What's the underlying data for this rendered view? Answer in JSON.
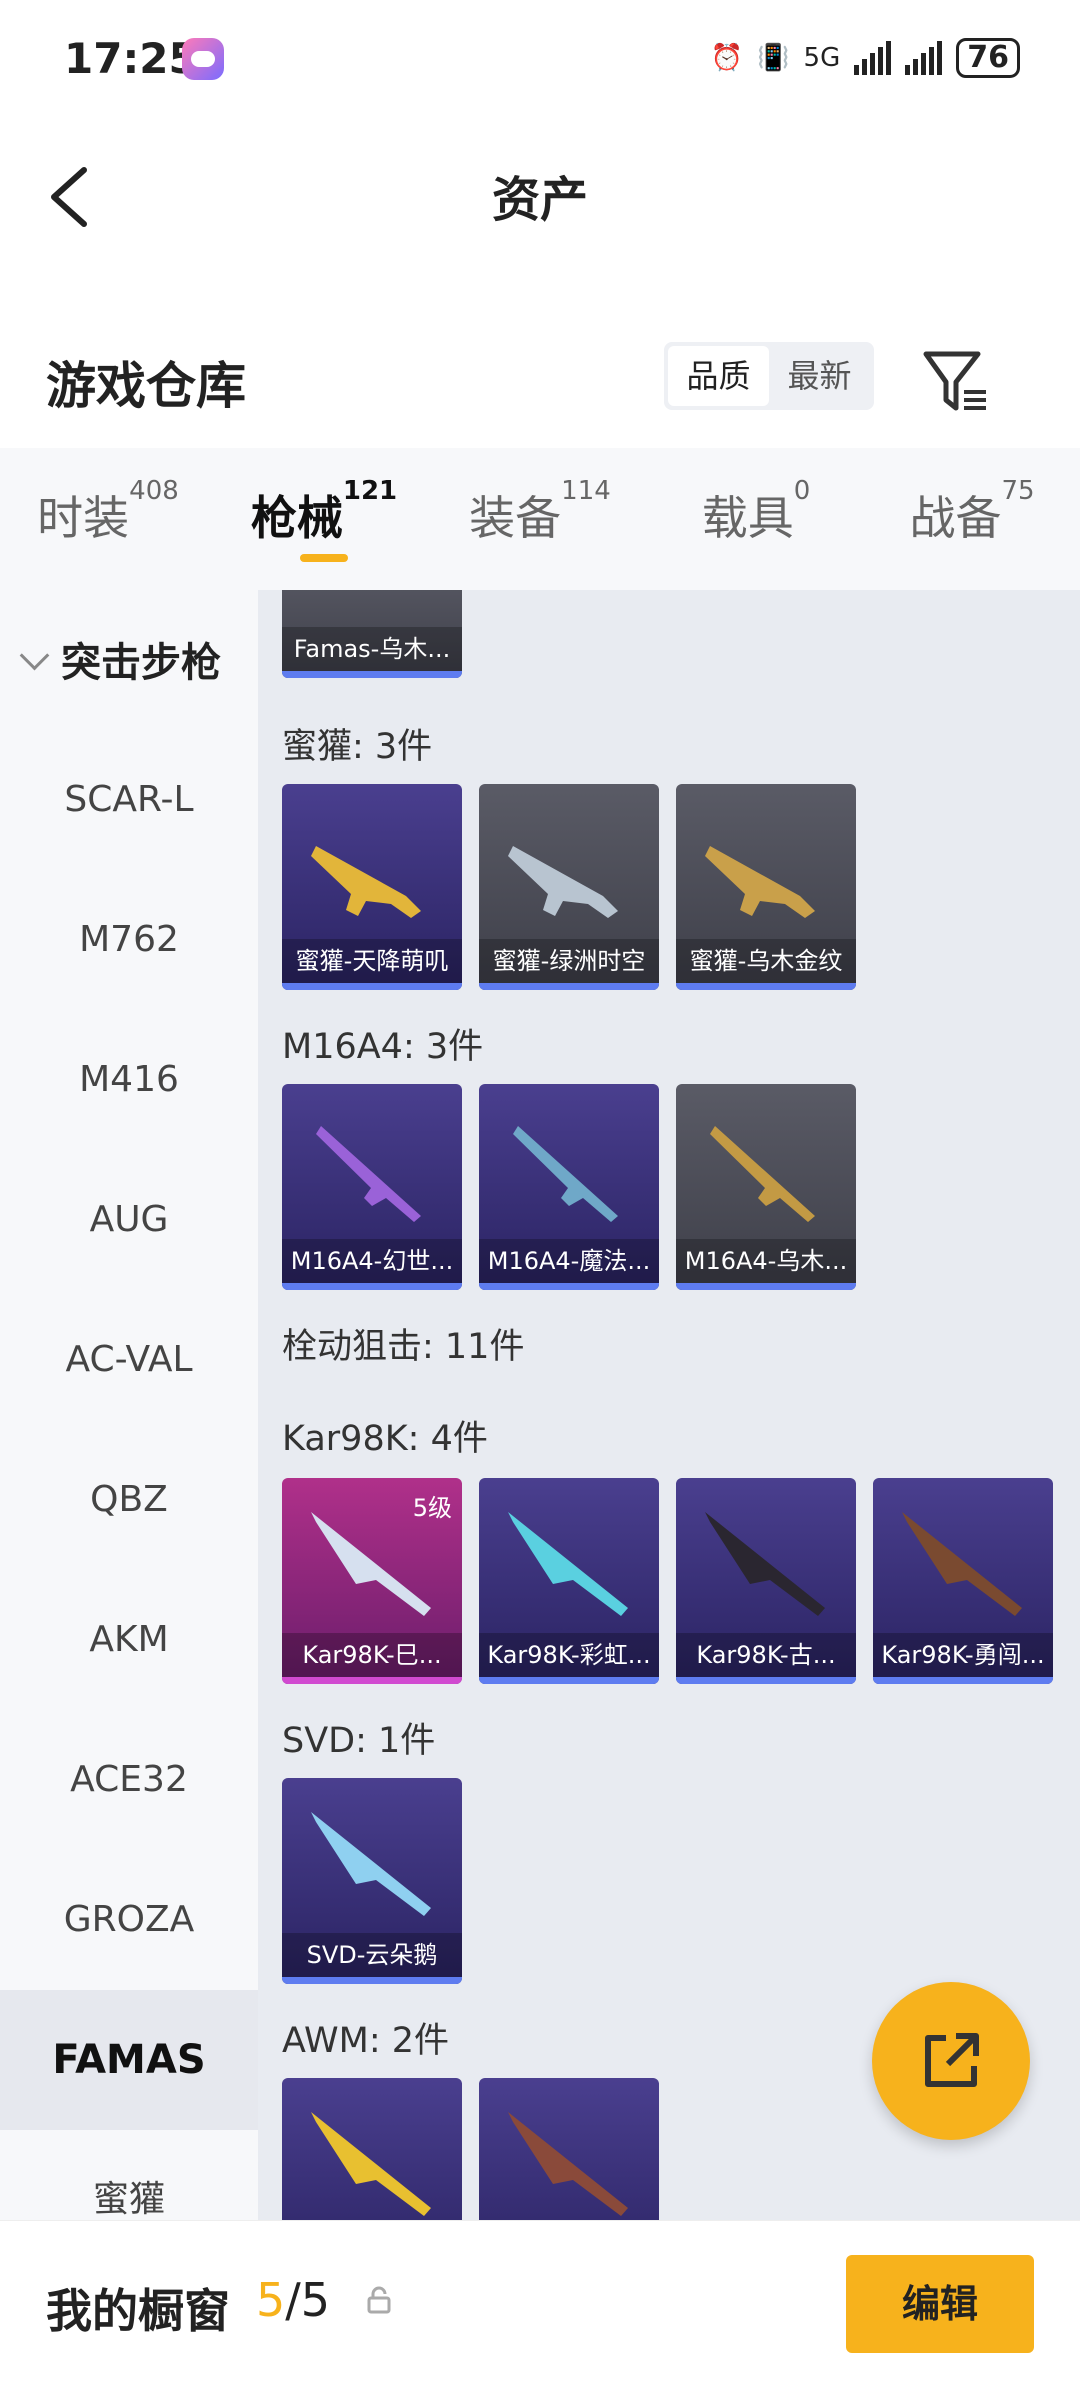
{
  "status_bar": {
    "time": "17:25",
    "network": "5G",
    "battery": "76"
  },
  "header": {
    "title": "资产"
  },
  "section": {
    "title": "游戏仓库",
    "sort_options": [
      "品质",
      "最新"
    ]
  },
  "tabs": [
    {
      "label": "时装",
      "count": "408"
    },
    {
      "label": "枪械",
      "count": "121"
    },
    {
      "label": "装备",
      "count": "114"
    },
    {
      "label": "载具",
      "count": "0"
    },
    {
      "label": "战备",
      "count": "75"
    }
  ],
  "sidebar": {
    "category": "突击步枪",
    "items": [
      "SCAR-L",
      "M762",
      "M416",
      "AUG",
      "AC-VAL",
      "QBZ",
      "AKM",
      "ACE32",
      "GROZA",
      "FAMAS",
      "蜜獾"
    ]
  },
  "groups": [
    {
      "title": "蜜獾: 3件"
    },
    {
      "title": "M16A4: 3件"
    },
    {
      "title": "栓动狙击: 11件"
    },
    {
      "title": "Kar98K: 4件"
    },
    {
      "title": "SVD: 1件"
    },
    {
      "title": "AWM: 2件"
    }
  ],
  "cards": [
    {
      "label": "Famas-乌木..."
    },
    {
      "label": "蜜獾-天降萌叽"
    },
    {
      "label": "蜜獾-绿洲时空"
    },
    {
      "label": "蜜獾-乌木金纹"
    },
    {
      "label": "M16A4-幻世..."
    },
    {
      "label": "M16A4-魔法..."
    },
    {
      "label": "M16A4-乌木..."
    },
    {
      "label": "Kar98K-巳...",
      "level": "5级"
    },
    {
      "label": "Kar98K-彩虹..."
    },
    {
      "label": "Kar98K-古..."
    },
    {
      "label": "Kar98K-勇闯..."
    },
    {
      "label": "SVD-云朵鹅"
    },
    {
      "label": ""
    },
    {
      "label": ""
    }
  ],
  "bottom": {
    "label": "我的橱窗",
    "count_current": "5",
    "count_sep": "/",
    "count_total": "5",
    "edit_label": "编辑"
  },
  "colors": {
    "accent": "#f7b21c",
    "card_blue": "#4a3f8f",
    "card_pink": "#b0308a"
  }
}
